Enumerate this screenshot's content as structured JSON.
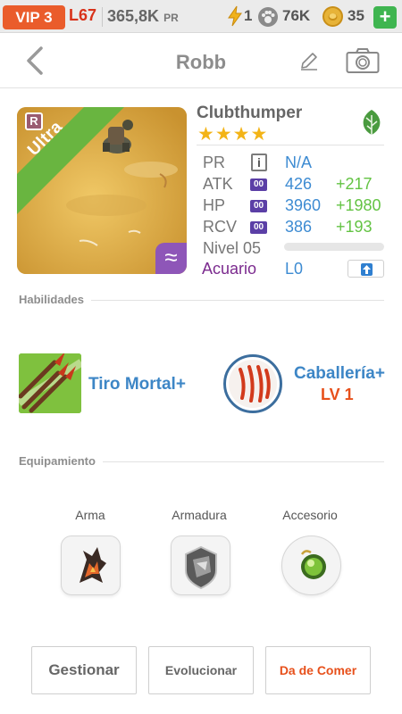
{
  "status_bar": {
    "vip": "VIP 3",
    "level": "L67",
    "pr_value": "365,8K",
    "pr_unit": "PR",
    "energy": "1",
    "paws": "76K",
    "coins": "35",
    "plus_label": "+"
  },
  "header": {
    "title": "Robb"
  },
  "card": {
    "rarity_badge": "R",
    "rarity_ribbon": "Ultra",
    "type_symbol": "≈"
  },
  "monster": {
    "name": "Clubthumper",
    "stars": "★★★★",
    "element": "leaf-icon",
    "stats": {
      "pr_label": "PR",
      "pr_value": "N/A",
      "atk_label": "ATK",
      "atk_value": "426",
      "atk_bonus": "+217",
      "hp_label": "HP",
      "hp_value": "3960",
      "hp_bonus": "+1980",
      "rcv_label": "RCV",
      "rcv_value": "386",
      "rcv_bonus": "+193",
      "mini_badge": "00",
      "info_icon_glyph": "i"
    },
    "level_label": "Nivel 05",
    "level_progress": 0,
    "family_label": "Acuario",
    "family_value": "L0"
  },
  "sections": {
    "skills_heading": "Habilidades",
    "equipment_heading": "Equipamiento"
  },
  "skills": [
    {
      "name": "Tiro Mortal+",
      "level": ""
    },
    {
      "name": "Caballería+",
      "level": "LV 1"
    }
  ],
  "equipment": [
    {
      "label": "Arma"
    },
    {
      "label": "Armadura"
    },
    {
      "label": "Accesorio"
    }
  ],
  "actions": {
    "manage": "Gestionar",
    "evolve": "Evolucionar",
    "feed": "Da de Comer"
  },
  "colors": {
    "accent_orange": "#ea5c2b",
    "link_blue": "#3d8bd2",
    "bonus_green": "#63c343",
    "family_purple": "#7b2a8e",
    "ultra_green": "#69b540"
  }
}
